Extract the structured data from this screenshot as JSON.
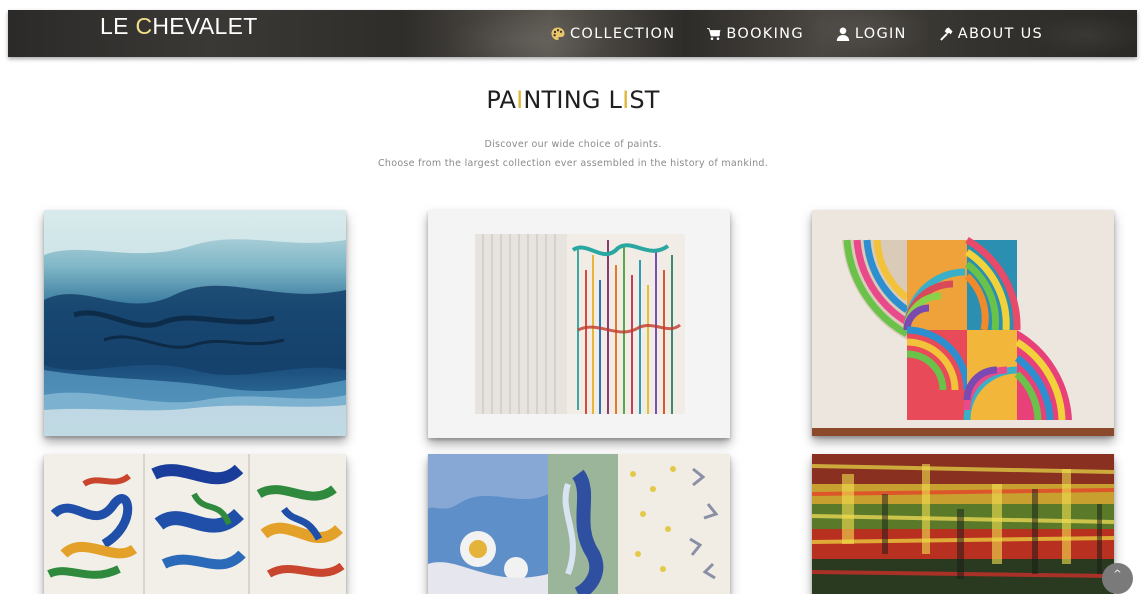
{
  "brand": {
    "part1": "LE ",
    "c": "C",
    "part2": "HEVALET"
  },
  "nav": {
    "items": [
      {
        "label": "COLLECTION",
        "icon": "palette-icon"
      },
      {
        "label": "BOOKING",
        "icon": "cart-icon"
      },
      {
        "label": "LOGIN",
        "icon": "user-icon"
      },
      {
        "label": "ABOUT US",
        "icon": "hammer-icon"
      }
    ]
  },
  "header": {
    "title_a": "PA",
    "title_i1": "I",
    "title_b": "NTING L",
    "title_i2": "I",
    "title_c": "ST",
    "subtitle_line1": "Discover our wide choice of paints.",
    "subtitle_line2": "Choose from the largest collection ever assembled in the history of mankind."
  },
  "paintings": [
    {
      "name": "painting-1"
    },
    {
      "name": "painting-2"
    },
    {
      "name": "painting-3"
    },
    {
      "name": "painting-4"
    },
    {
      "name": "painting-5"
    },
    {
      "name": "painting-6"
    }
  ],
  "scroll_top": {
    "glyph": "^",
    "icon": "chevron-up-icon"
  },
  "colors": {
    "accent": "#e0b637",
    "brand": "#e9d06a",
    "nav_bg": "#2f2d2a"
  }
}
